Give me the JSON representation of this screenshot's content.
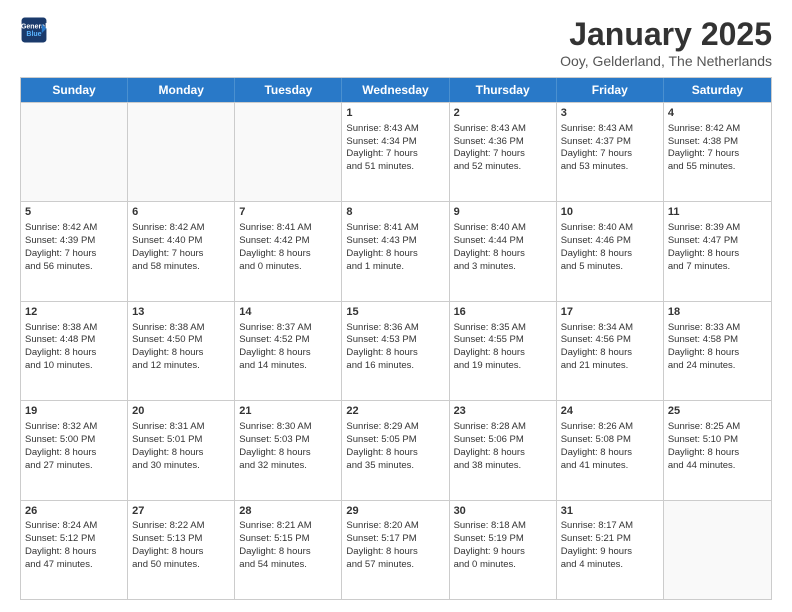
{
  "header": {
    "logo_line1": "General",
    "logo_line2": "Blue",
    "month": "January 2025",
    "location": "Ooy, Gelderland, The Netherlands"
  },
  "days": [
    "Sunday",
    "Monday",
    "Tuesday",
    "Wednesday",
    "Thursday",
    "Friday",
    "Saturday"
  ],
  "weeks": [
    [
      {
        "day": "",
        "text": ""
      },
      {
        "day": "",
        "text": ""
      },
      {
        "day": "",
        "text": ""
      },
      {
        "day": "1",
        "text": "Sunrise: 8:43 AM\nSunset: 4:34 PM\nDaylight: 7 hours\nand 51 minutes."
      },
      {
        "day": "2",
        "text": "Sunrise: 8:43 AM\nSunset: 4:36 PM\nDaylight: 7 hours\nand 52 minutes."
      },
      {
        "day": "3",
        "text": "Sunrise: 8:43 AM\nSunset: 4:37 PM\nDaylight: 7 hours\nand 53 minutes."
      },
      {
        "day": "4",
        "text": "Sunrise: 8:42 AM\nSunset: 4:38 PM\nDaylight: 7 hours\nand 55 minutes."
      }
    ],
    [
      {
        "day": "5",
        "text": "Sunrise: 8:42 AM\nSunset: 4:39 PM\nDaylight: 7 hours\nand 56 minutes."
      },
      {
        "day": "6",
        "text": "Sunrise: 8:42 AM\nSunset: 4:40 PM\nDaylight: 7 hours\nand 58 minutes."
      },
      {
        "day": "7",
        "text": "Sunrise: 8:41 AM\nSunset: 4:42 PM\nDaylight: 8 hours\nand 0 minutes."
      },
      {
        "day": "8",
        "text": "Sunrise: 8:41 AM\nSunset: 4:43 PM\nDaylight: 8 hours\nand 1 minute."
      },
      {
        "day": "9",
        "text": "Sunrise: 8:40 AM\nSunset: 4:44 PM\nDaylight: 8 hours\nand 3 minutes."
      },
      {
        "day": "10",
        "text": "Sunrise: 8:40 AM\nSunset: 4:46 PM\nDaylight: 8 hours\nand 5 minutes."
      },
      {
        "day": "11",
        "text": "Sunrise: 8:39 AM\nSunset: 4:47 PM\nDaylight: 8 hours\nand 7 minutes."
      }
    ],
    [
      {
        "day": "12",
        "text": "Sunrise: 8:38 AM\nSunset: 4:48 PM\nDaylight: 8 hours\nand 10 minutes."
      },
      {
        "day": "13",
        "text": "Sunrise: 8:38 AM\nSunset: 4:50 PM\nDaylight: 8 hours\nand 12 minutes."
      },
      {
        "day": "14",
        "text": "Sunrise: 8:37 AM\nSunset: 4:52 PM\nDaylight: 8 hours\nand 14 minutes."
      },
      {
        "day": "15",
        "text": "Sunrise: 8:36 AM\nSunset: 4:53 PM\nDaylight: 8 hours\nand 16 minutes."
      },
      {
        "day": "16",
        "text": "Sunrise: 8:35 AM\nSunset: 4:55 PM\nDaylight: 8 hours\nand 19 minutes."
      },
      {
        "day": "17",
        "text": "Sunrise: 8:34 AM\nSunset: 4:56 PM\nDaylight: 8 hours\nand 21 minutes."
      },
      {
        "day": "18",
        "text": "Sunrise: 8:33 AM\nSunset: 4:58 PM\nDaylight: 8 hours\nand 24 minutes."
      }
    ],
    [
      {
        "day": "19",
        "text": "Sunrise: 8:32 AM\nSunset: 5:00 PM\nDaylight: 8 hours\nand 27 minutes."
      },
      {
        "day": "20",
        "text": "Sunrise: 8:31 AM\nSunset: 5:01 PM\nDaylight: 8 hours\nand 30 minutes."
      },
      {
        "day": "21",
        "text": "Sunrise: 8:30 AM\nSunset: 5:03 PM\nDaylight: 8 hours\nand 32 minutes."
      },
      {
        "day": "22",
        "text": "Sunrise: 8:29 AM\nSunset: 5:05 PM\nDaylight: 8 hours\nand 35 minutes."
      },
      {
        "day": "23",
        "text": "Sunrise: 8:28 AM\nSunset: 5:06 PM\nDaylight: 8 hours\nand 38 minutes."
      },
      {
        "day": "24",
        "text": "Sunrise: 8:26 AM\nSunset: 5:08 PM\nDaylight: 8 hours\nand 41 minutes."
      },
      {
        "day": "25",
        "text": "Sunrise: 8:25 AM\nSunset: 5:10 PM\nDaylight: 8 hours\nand 44 minutes."
      }
    ],
    [
      {
        "day": "26",
        "text": "Sunrise: 8:24 AM\nSunset: 5:12 PM\nDaylight: 8 hours\nand 47 minutes."
      },
      {
        "day": "27",
        "text": "Sunrise: 8:22 AM\nSunset: 5:13 PM\nDaylight: 8 hours\nand 50 minutes."
      },
      {
        "day": "28",
        "text": "Sunrise: 8:21 AM\nSunset: 5:15 PM\nDaylight: 8 hours\nand 54 minutes."
      },
      {
        "day": "29",
        "text": "Sunrise: 8:20 AM\nSunset: 5:17 PM\nDaylight: 8 hours\nand 57 minutes."
      },
      {
        "day": "30",
        "text": "Sunrise: 8:18 AM\nSunset: 5:19 PM\nDaylight: 9 hours\nand 0 minutes."
      },
      {
        "day": "31",
        "text": "Sunrise: 8:17 AM\nSunset: 5:21 PM\nDaylight: 9 hours\nand 4 minutes."
      },
      {
        "day": "",
        "text": ""
      }
    ]
  ]
}
